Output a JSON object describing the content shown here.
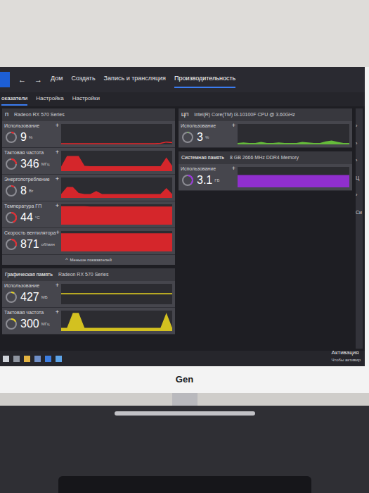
{
  "nav": {
    "back": "←",
    "forward": "→",
    "tabs": [
      {
        "label": "Дом",
        "selected": false
      },
      {
        "label": "Создать",
        "selected": false
      },
      {
        "label": "Запись и трансляция",
        "selected": false
      },
      {
        "label": "Производительность",
        "selected": true
      }
    ]
  },
  "subtabs": [
    {
      "label": "оказатели",
      "selected": true
    },
    {
      "label": "Настройка",
      "selected": false
    },
    {
      "label": "Настройки",
      "selected": false
    }
  ],
  "gpu_panel": {
    "title": "П",
    "device": "Radeon RX 570 Series",
    "color": "#e8262b",
    "less_icon": "^",
    "less_link": "Меньше показателей",
    "metrics": [
      {
        "label": "Использование",
        "pin": "+",
        "value": "9",
        "unit": "%",
        "level": 0.09,
        "chart": {
          "kind": "line",
          "max": 100,
          "values": [
            4,
            4,
            4,
            4,
            4,
            4,
            4,
            4,
            4,
            4,
            4,
            4,
            4,
            4,
            4,
            4,
            4,
            5,
            12,
            9
          ]
        }
      },
      {
        "label": "Тактовая частота",
        "pin": "+",
        "value": "346",
        "unit": "МГц",
        "level": 0.25,
        "chart": {
          "kind": "area",
          "max": 1300,
          "values": [
            300,
            1000,
            1000,
            1000,
            350,
            320,
            320,
            320,
            320,
            320,
            320,
            320,
            320,
            320,
            320,
            320,
            320,
            320,
            900,
            346
          ]
        }
      },
      {
        "label": "Энергопотребление",
        "pin": "+",
        "value": "8",
        "unit": "Вт",
        "level": 0.1,
        "chart": {
          "kind": "area",
          "max": 40,
          "values": [
            8,
            22,
            22,
            10,
            8,
            8,
            14,
            8,
            8,
            8,
            8,
            8,
            8,
            8,
            8,
            8,
            8,
            8,
            20,
            8
          ]
        }
      },
      {
        "label": "Температура ГП",
        "pin": "+",
        "value": "44",
        "unit": "°C",
        "level": 0.44,
        "chart": {
          "kind": "area",
          "max": 48,
          "values": [
            45,
            45,
            45,
            45,
            45,
            44,
            44,
            44,
            44,
            44,
            44,
            44,
            44,
            44,
            44,
            44,
            44,
            44,
            44,
            44
          ]
        }
      },
      {
        "label": "Скорость вентилятора",
        "pin": "+",
        "value": "871",
        "unit": "об/мин",
        "level": 0.3,
        "chart": {
          "kind": "area",
          "max": 950,
          "values": [
            875,
            875,
            872,
            872,
            871,
            871,
            871,
            871,
            871,
            871,
            871,
            871,
            871,
            871,
            871,
            871,
            871,
            871,
            871,
            871
          ]
        }
      }
    ]
  },
  "memory_panel": {
    "title": "Графическая память",
    "device": "Radeon RX 570 Series",
    "color": "#e6d21f",
    "metrics": [
      {
        "label": "Использование",
        "pin": "+",
        "value": "427",
        "unit": "МБ",
        "level": 0.1,
        "chart": {
          "kind": "line",
          "max": 800,
          "values": [
            427,
            427,
            427,
            427,
            427,
            427,
            427,
            427,
            427,
            427,
            427,
            427,
            427,
            427,
            427,
            427,
            427,
            427,
            427,
            427
          ]
        }
      },
      {
        "label": "Тактовая частота",
        "pin": "+",
        "value": "300",
        "unit": "МГц",
        "level": 0.17,
        "chart": {
          "kind": "area",
          "max": 1900,
          "values": [
            300,
            300,
            1750,
            1750,
            300,
            300,
            300,
            300,
            300,
            300,
            300,
            300,
            300,
            300,
            300,
            300,
            300,
            300,
            1750,
            300
          ]
        }
      }
    ]
  },
  "cpu_panel": {
    "title": "ЦП",
    "device": "Intel(R) Core(TM) i3-10100F CPU @ 3.60GHz",
    "color": "#6ccb3c",
    "metrics": [
      {
        "label": "Использование",
        "pin": "+",
        "value": "3",
        "unit": "%",
        "level": 0.03,
        "chart": {
          "kind": "area",
          "max": 40,
          "values": [
            3,
            4,
            3,
            3,
            5,
            3,
            3,
            4,
            3,
            3,
            3,
            5,
            4,
            3,
            3,
            6,
            8,
            5,
            3,
            3
          ]
        }
      }
    ]
  },
  "ram_panel": {
    "title": "Системная память",
    "device": "8 GB 2666 MHz DDR4 Memory",
    "color": "#9b30e0",
    "metrics": [
      {
        "label": "Использование",
        "pin": "+",
        "value": "3.1",
        "unit": "ГБ",
        "level": 0.39,
        "chart": {
          "kind": "area",
          "max": 5,
          "values": [
            3.1,
            3.1,
            3.1,
            3.1,
            3.1,
            3.1,
            3.1,
            3.1,
            3.1,
            3.1,
            3.1,
            3.1,
            3.1,
            3.1,
            3.1,
            3.1,
            3.1,
            3.1,
            3.1,
            3.1
          ]
        }
      }
    ]
  },
  "right_strip": [
    "›",
    "›",
    "›",
    "Ц",
    "›",
    "Си"
  ],
  "watermark": {
    "title": "Активация",
    "text": "Чтобы активир"
  },
  "monitor": {
    "brand": "Gen"
  }
}
